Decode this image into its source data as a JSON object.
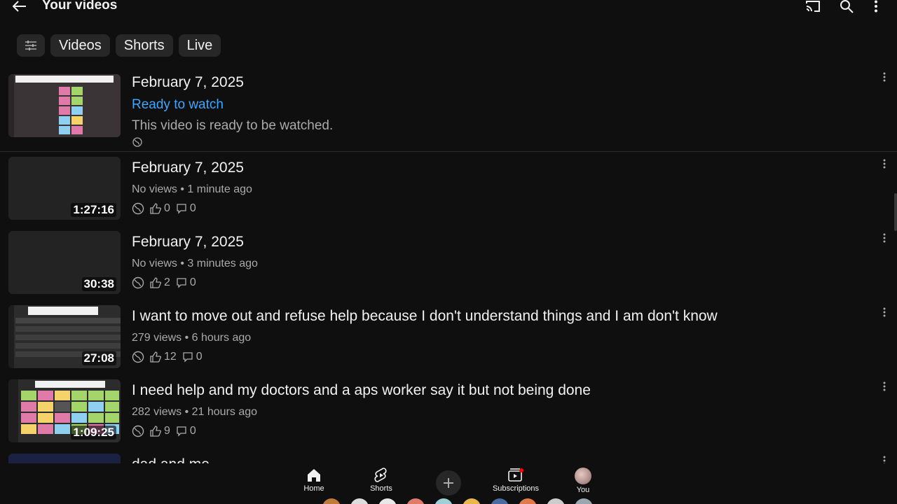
{
  "header": {
    "title": "Your videos"
  },
  "chips": {
    "videos": "Videos",
    "shorts": "Shorts",
    "live": "Live"
  },
  "videos": [
    {
      "title": "February 7, 2025",
      "status": "Ready to watch",
      "status_desc": "This video is ready to be watched."
    },
    {
      "title": "February 7, 2025",
      "duration": "1:27:16",
      "meta": "No views • 1 minute ago",
      "likes": "0",
      "comments": "0"
    },
    {
      "title": "February 7, 2025",
      "duration": "30:38",
      "meta": "No views • 3 minutes ago",
      "likes": "2",
      "comments": "0"
    },
    {
      "title": "I want to move out and refuse help because I don't understand things and I am don't know",
      "duration": "27:08",
      "meta": "279 views • 6 hours ago",
      "likes": "12",
      "comments": "0"
    },
    {
      "title": "I need help and my doctors and a aps worker say it but not being done",
      "duration": "1:09:25",
      "meta": "282 views • 21 hours ago",
      "likes": "9",
      "comments": "0"
    },
    {
      "title": "dad and me"
    }
  ],
  "nav": {
    "home": "Home",
    "shorts": "Shorts",
    "subscriptions": "Subscriptions",
    "you": "You"
  },
  "colors": {
    "background": "#0f0f0f",
    "chip": "#272727",
    "link_blue": "#3ea6ff",
    "secondary_text": "#aaaaaa"
  },
  "icons": [
    "back-arrow-icon",
    "cast-icon",
    "search-icon",
    "more-vert-icon",
    "filter-icon",
    "globe-icon",
    "thumb-up-icon",
    "comment-icon",
    "home-icon",
    "shorts-icon",
    "plus-icon",
    "subscriptions-icon"
  ]
}
